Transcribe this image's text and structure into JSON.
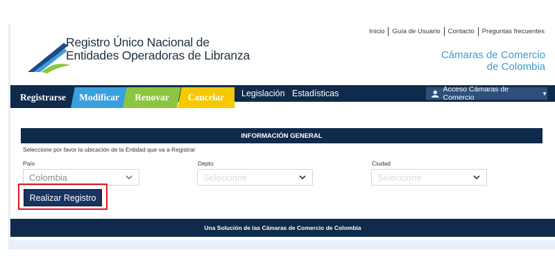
{
  "header": {
    "title_line1": "Registro Único Nacional de",
    "title_line2": "Entidades Operadoras de Libranza",
    "top_links": [
      "Inicio",
      "Guía de Usuario",
      "Contacto",
      "Preguntas frecuentes"
    ],
    "camaras_line1": "Cámaras de Comercio",
    "camaras_line2": "de Colombia"
  },
  "nav": {
    "tabs": [
      "Registrarse",
      "Modificar",
      "Renovar",
      "Cancelar"
    ],
    "links": [
      "Legislación",
      "Estadísticas"
    ],
    "acceso_label": "Acceso Cámaras de Comercio"
  },
  "form": {
    "section_title": "INFORMACIÓN GENERAL",
    "instruction": "Seleccione por favor la ubicación de la Entidad que va a Registrar",
    "pais_label": "País",
    "pais_value": "Colombia",
    "depto_label": "Depto",
    "depto_value": "Seleccione",
    "ciudad_label": "Ciudad",
    "ciudad_value": "Seleccione",
    "submit_label": "Realizar Registro"
  },
  "footer": {
    "text": "Una Solución de las Cámaras de Comercio de Colombia"
  },
  "colors": {
    "navy": "#0f2a4a",
    "modify": "#3aa0dc",
    "renew": "#8cc63f",
    "cancel": "#f5c800",
    "accent_blue": "#3a9ad9",
    "highlight_red": "#e0151b"
  }
}
